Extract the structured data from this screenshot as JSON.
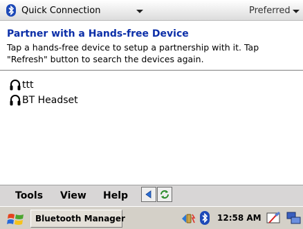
{
  "header": {
    "connection_label": "Quick Connection",
    "preferred_label": "Preferred",
    "icon": "bluetooth-icon"
  },
  "content": {
    "title": "Partner with a Hands-free Device",
    "instructions": "Tap a hands-free device to setup a partnership with it. Tap \"Refresh\" button to search the devices again.",
    "devices": [
      {
        "name": "ttt",
        "icon": "headset-icon"
      },
      {
        "name": "BT Headset",
        "icon": "headset-icon"
      }
    ]
  },
  "menubar": {
    "tools": "Tools",
    "view": "View",
    "help": "Help"
  },
  "taskbar": {
    "app_name": "Bluetooth Manager",
    "time": "12:58 AM"
  },
  "colors": {
    "title": "#0b2ea8",
    "bluetooth": "#1d49b8",
    "menubar": "#d8d6d6",
    "taskbar": "#d4d0c8"
  }
}
